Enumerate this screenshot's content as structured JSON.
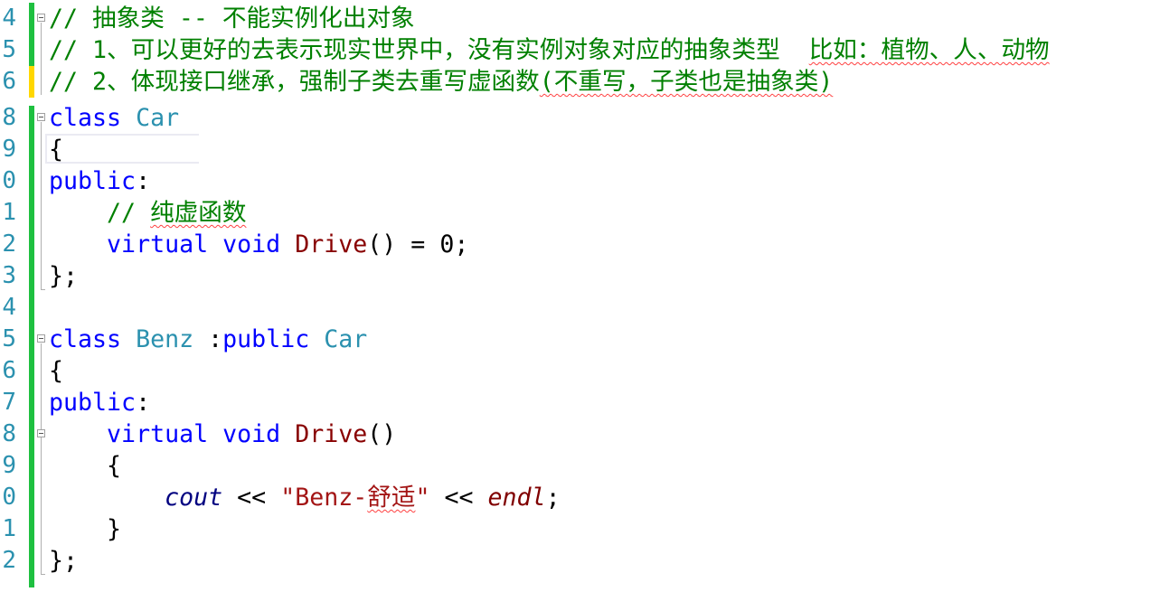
{
  "editor": {
    "line_numbers": [
      "4",
      "5",
      "6",
      "8",
      "9",
      "0",
      "1",
      "2",
      "3",
      "4",
      "5",
      "6",
      "7",
      "8",
      "9",
      "0",
      "1",
      "2"
    ],
    "comments": {
      "line1_prefix": "// ",
      "line1_text": "抽象类 -- 不能实例化出对象",
      "line2_prefix": "// ",
      "line2_text": "1、可以更好的去表示现实世界中，没有实例对象对应的抽象类型  ",
      "line2_squiggle": "比如：植物、人、动物",
      "line3_prefix": "// ",
      "line3_text": "2、体现接口继承，强制子类去重写虚函数",
      "line3_squiggle": "(不重写，子类也是抽象类)"
    },
    "car_class": {
      "kw_class": "class",
      "name": "Car",
      "open_brace": "{",
      "access": "public",
      "colon": ":",
      "indent": "    ",
      "comment_prefix": "// ",
      "comment_text": "纯虚函数",
      "kw_virtual": "virtual",
      "kw_void": "void",
      "method": "Drive",
      "parens": "()",
      "pure_suffix": " = 0;",
      "close_brace": "};"
    },
    "benz_class": {
      "kw_class": "class",
      "name": "Benz",
      "colon": " :",
      "kw_public": "public",
      "base": "Car",
      "open_brace": "{",
      "access": "public",
      "access_colon": ":",
      "indent": "    ",
      "kw_virtual": "virtual",
      "kw_void": "void",
      "method": "Drive",
      "parens": "()",
      "method_open": "{",
      "indent2": "        ",
      "cout": "cout",
      "op": " << ",
      "str_open": "\"Benz-",
      "str_cjk": "舒适",
      "str_close": "\"",
      "endl": "endl",
      "semi": ";",
      "method_close": "}",
      "close_brace": "};"
    },
    "colors": {
      "keyword": "#0000ff",
      "type": "#2b91af",
      "comment": "#008000",
      "function": "#880000",
      "string": "#a31515",
      "change_saved": "#1ec040",
      "change_unsaved": "#ffd700"
    }
  }
}
